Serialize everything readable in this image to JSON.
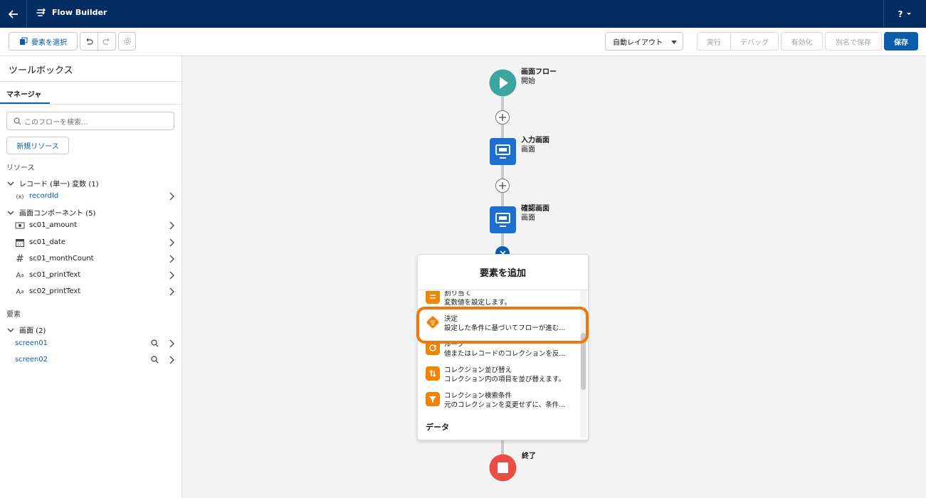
{
  "header": {
    "title": "Flow Builder",
    "help_label": "?"
  },
  "toolbar": {
    "select_element_label": "要素を選択",
    "layout_value": "自動レイアウト",
    "run_label": "実行",
    "debug_label": "デバッグ",
    "activate_label": "有効化",
    "save_as_label": "別名で保存",
    "save_label": "保存"
  },
  "sidebar": {
    "title": "ツールボックス",
    "tab_label": "マネージャ",
    "search_placeholder": "このフローを検索...",
    "new_resource_label": "新規リソース",
    "resources_label": "リソース",
    "record_group": {
      "label": "レコード (単一) 変数 (1)",
      "items": [
        {
          "label": "recordId",
          "icon": "variable-icon"
        }
      ]
    },
    "screen_component_group": {
      "label": "画面コンポーネント (5)",
      "items": [
        {
          "label": "sc01_amount",
          "icon": "currency-icon"
        },
        {
          "label": "sc01_date",
          "icon": "calendar-icon"
        },
        {
          "label": "sc01_monthCount",
          "icon": "number-icon"
        },
        {
          "label": "sc01_printText",
          "icon": "text-icon"
        },
        {
          "label": "sc02_printText",
          "icon": "text-icon"
        }
      ]
    },
    "elements_label": "要素",
    "screen_group": {
      "label": "画面 (2)",
      "items": [
        {
          "label": "screen01"
        },
        {
          "label": "screen02"
        }
      ]
    }
  },
  "canvas": {
    "start_node": {
      "title": "画面フロー",
      "subtitle": "開始"
    },
    "screen1_node": {
      "title": "入力画面",
      "subtitle": "画面"
    },
    "screen2_node": {
      "title": "確認画面",
      "subtitle": "画面"
    },
    "end_node": {
      "title": "終了"
    }
  },
  "add_panel": {
    "title": "要素を追加",
    "items": [
      {
        "name": "割り当て",
        "desc": "変数値を設定します。",
        "icon": "assignment-icon"
      },
      {
        "name": "決定",
        "desc": "設定した条件に基づいてフローが進む...",
        "icon": "decision-icon"
      },
      {
        "name": "ループ",
        "desc": "値またはレコードのコレクションを反...",
        "icon": "loop-icon"
      },
      {
        "name": "コレクション並び替え",
        "desc": "コレクション内の項目を並び替えます。",
        "icon": "sort-icon"
      },
      {
        "name": "コレクション検索条件",
        "desc": "元のコレクションを変更せずに、条件...",
        "icon": "filter-icon"
      }
    ],
    "category_data": "データ"
  },
  "colors": {
    "header_bg": "#032d60",
    "brand": "#0b5cab",
    "start": "#3ba59e",
    "end": "#ea4d43",
    "logic": "#f38303",
    "highlight": "#f0780a"
  }
}
